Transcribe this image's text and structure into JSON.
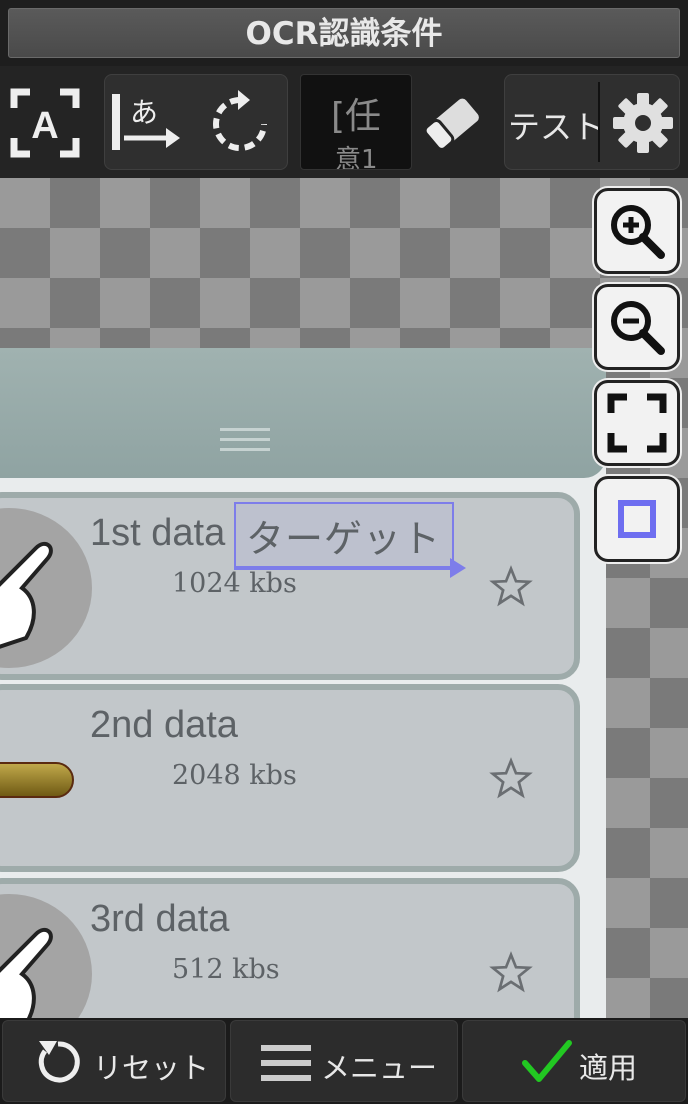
{
  "window": {
    "title": "OCR認識条件"
  },
  "toolbar": {
    "char_filter_line1": "[任",
    "char_filter_line2": "意1",
    "test_label": "テスト"
  },
  "cards": [
    {
      "title": "1st data",
      "size": "1024 kbs"
    },
    {
      "title": "2nd data",
      "size": "2048 kbs"
    },
    {
      "title": "3rd data",
      "size": "512 kbs"
    }
  ],
  "selection": {
    "text": "ターゲット"
  },
  "bottom": {
    "reset_label": "リセット",
    "menu_label": "メニュー",
    "apply_label": "適用"
  },
  "colors": {
    "selection": "#7d7dea",
    "apply_check": "#22c822",
    "card_bg": "#c2c7ca",
    "header_bg": "#9aacab"
  }
}
